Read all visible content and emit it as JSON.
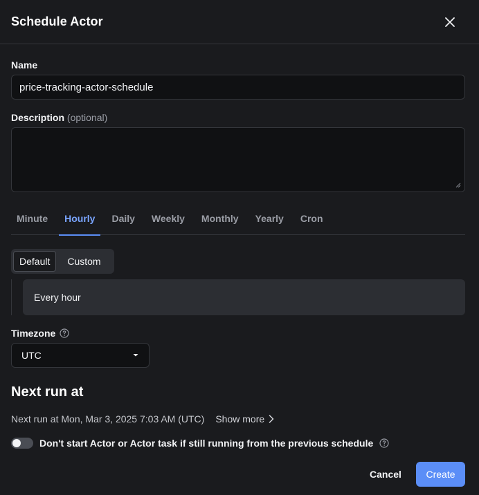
{
  "dialog": {
    "title": "Schedule Actor"
  },
  "form": {
    "name_label": "Name",
    "name_value": "price-tracking-actor-schedule",
    "description_label": "Description",
    "description_optional": "(optional)",
    "description_value": ""
  },
  "frequency_tabs": [
    {
      "label": "Minute",
      "active": false
    },
    {
      "label": "Hourly",
      "active": true
    },
    {
      "label": "Daily",
      "active": false
    },
    {
      "label": "Weekly",
      "active": false
    },
    {
      "label": "Monthly",
      "active": false
    },
    {
      "label": "Yearly",
      "active": false
    },
    {
      "label": "Cron",
      "active": false
    }
  ],
  "mode": {
    "default_label": "Default",
    "custom_label": "Custom",
    "selected": "Default"
  },
  "schedule_summary": "Every hour",
  "timezone": {
    "label": "Timezone",
    "value": "UTC"
  },
  "next_run": {
    "heading": "Next run at",
    "text": "Next run at Mon, Mar 3, 2025 7:03 AM (UTC)",
    "show_more_label": "Show more"
  },
  "skip_toggle": {
    "label": "Don't start Actor or Actor task if still running from the previous schedule",
    "enabled": false
  },
  "actions": {
    "cancel_label": "Cancel",
    "create_label": "Create"
  },
  "colors": {
    "background": "#1a1b1e",
    "accent": "#5b8ef7",
    "active_tab": "#7aa5ff"
  }
}
